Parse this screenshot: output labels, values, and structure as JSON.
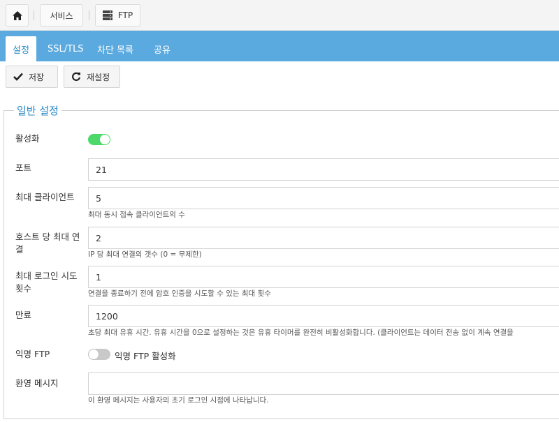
{
  "breadcrumb": {
    "home_icon": "home-icon",
    "services_label": "서비스",
    "ftp_label": "FTP",
    "ftp_icon": "server-icon"
  },
  "tabs": [
    {
      "label": "설정",
      "active": true
    },
    {
      "label": "SSL/TLS",
      "active": false
    },
    {
      "label": "차단 목록",
      "active": false
    },
    {
      "label": "공유",
      "active": false
    }
  ],
  "toolbar": {
    "save_label": "저장",
    "reset_label": "재설정"
  },
  "general": {
    "legend": "일반 설정",
    "enable_label": "활성화",
    "enable_on": true,
    "port_label": "포트",
    "port_value": "21",
    "max_clients_label": "최대 클라이언트",
    "max_clients_value": "5",
    "max_clients_help": "최대 동시 접속 클라이언트의 수",
    "per_host_label": "호스트 당 최대 연결",
    "per_host_value": "2",
    "per_host_help": "IP 당 최대 연결의 갯수 (0 = 무제한)",
    "login_attempts_label": "최대 로그인 시도 횟수",
    "login_attempts_value": "1",
    "login_attempts_help": "연결을 종료하기 전에 암호 인증을 시도할 수 있는 최대 횟수",
    "timeout_label": "만료",
    "timeout_value": "1200",
    "timeout_help": "초당 최대 유휴 시간. 유휴 시간을 0으로 설정하는 것은 유휴 타이머를 완전히 비활성화합니다. (클라이언트는 데이터 전송 없이 계속 연결을",
    "anon_label": "익명 FTP",
    "anon_toggle_text": "익명 FTP 활성화",
    "anon_on": false,
    "welcome_label": "환영 메시지",
    "welcome_value": "",
    "welcome_help": "이 환영 메시지는 사용자의 초기 로그인 시점에 나타납니다."
  },
  "colors": {
    "tabbar": "#5aa9df",
    "accent": "#2a8ac9",
    "toggle_on": "#4cd96a",
    "toggle_off": "#c9c9c9"
  }
}
